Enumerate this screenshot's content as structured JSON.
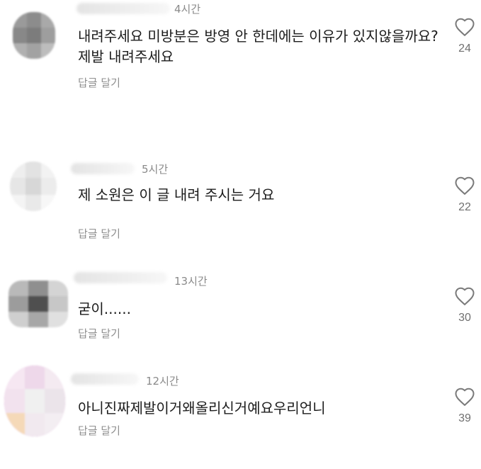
{
  "comments": [
    {
      "time": "4시간",
      "text": "내려주세요 미방분은 방영 안 한데에는 이유가 있지않을까요? 제발 내려주세요",
      "reply_label": "답글 달기",
      "likes": "24",
      "like_icon": "heart-outline-icon"
    },
    {
      "time": "5시간",
      "text": "제 소원은 이 글 내려 주시는 거요",
      "reply_label": "답글 달기",
      "likes": "22",
      "like_icon": "heart-outline-icon"
    },
    {
      "time": "13시간",
      "text": "굳이......",
      "reply_label": "답글 달기",
      "likes": "30",
      "like_icon": "heart-outline-icon"
    },
    {
      "time": "12시간",
      "text": "아니진짜제발이거왜올리신거예요우리언니",
      "reply_label": "답글 달기",
      "likes": "39",
      "like_icon": "heart-outline-icon"
    }
  ],
  "colors": {
    "text": "#1c1c1c",
    "meta": "#8a8a8a",
    "heart": "#7a7a7a",
    "background": "#ffffff"
  }
}
